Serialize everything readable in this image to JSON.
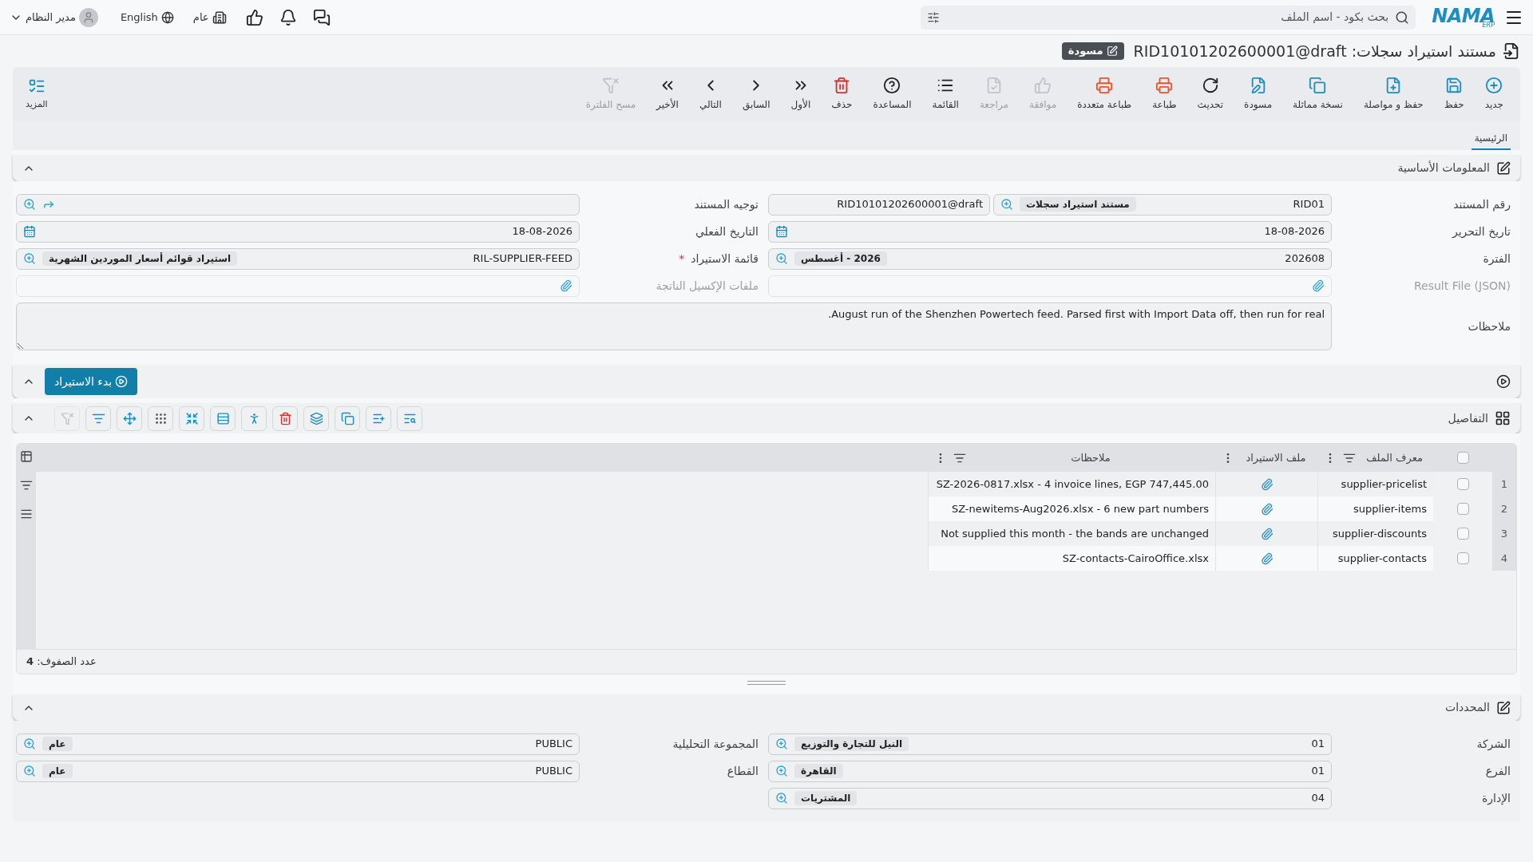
{
  "header": {
    "logo": "NAMA",
    "logo_sub": "ERP",
    "search": {
      "placeholder": "بحث بكود - اسم الملف"
    },
    "language": "English",
    "company": "عام",
    "user": "مدير النظام"
  },
  "document": {
    "title": "مستند استيراد سجلات: RID10101202600001@draft",
    "status": "مسودة"
  },
  "toolbar": [
    {
      "label": "جديد",
      "disabled": false
    },
    {
      "label": "حفظ",
      "disabled": false
    },
    {
      "label": "حفظ و مواصلة",
      "disabled": false
    },
    {
      "label": "نسخة مماثلة",
      "disabled": false
    },
    {
      "label": "مسودة",
      "disabled": false
    },
    {
      "label": "تحديث",
      "disabled": false
    },
    {
      "label": "طباعة",
      "disabled": false
    },
    {
      "label": "طباعة متعددة",
      "disabled": false
    },
    {
      "label": "موافقة",
      "disabled": true
    },
    {
      "label": "مراجعة",
      "disabled": true
    },
    {
      "label": "القائمة",
      "disabled": false
    },
    {
      "label": "المساعدة",
      "disabled": false
    },
    {
      "label": "حذف",
      "disabled": false
    },
    {
      "label": "الأول",
      "disabled": false
    },
    {
      "label": "السابق",
      "disabled": false
    },
    {
      "label": "التالي",
      "disabled": false
    },
    {
      "label": "الأخير",
      "disabled": false
    },
    {
      "label": "مسح الفلترة",
      "disabled": true
    }
  ],
  "more": "المزيد",
  "tabs": [
    {
      "label": "الرئيسية",
      "selected": true
    }
  ],
  "basic_info": {
    "title": "المعلومات الأساسية",
    "expanded": true,
    "fields": [
      {
        "kind": "lookup",
        "label": "رقم المستند",
        "value": "RID01",
        "tag": "مستند استيراد سجلات",
        "extra": "RID10101202600001@draft"
      },
      {
        "kind": "route",
        "label": "توجيه المستند"
      },
      {
        "kind": "date",
        "label": "تاريخ التحرير",
        "value": "18-08-2026"
      },
      {
        "kind": "date",
        "label": "التاريخ الفعلي",
        "value": "18-08-2026"
      },
      {
        "kind": "lookup",
        "label": "الفترة",
        "value": "202608",
        "tag": "2026 - أغسطس"
      },
      {
        "kind": "lookup",
        "label": "قائمة الاستيراد",
        "value": "RIL-SUPPLIER-FEED",
        "tag": "استيراد قوائم أسعار الموردين الشهرية",
        "required": true,
        "required_mark": "*"
      },
      {
        "kind": "file",
        "label": "Result File (JSON)"
      },
      {
        "kind": "file",
        "label": "ملفات الإكسيل الناتجة"
      }
    ],
    "notes": {
      "label": "ملاحظات",
      "value": "August run of the Shenzhen Powertech feed. Parsed first with Import Data off, then run for real."
    }
  },
  "run": {
    "button": "بدء الاستيراد",
    "expanded": true
  },
  "details": {
    "title": "التفاصيل",
    "expanded": true,
    "tools": [
      {
        "disabled": true
      },
      {
        "disabled": false
      },
      {
        "disabled": false
      },
      {
        "disabled": false
      },
      {
        "disabled": false
      },
      {
        "disabled": false
      },
      {
        "disabled": false
      },
      {
        "disabled": false
      },
      {
        "disabled": false
      },
      {
        "disabled": false
      },
      {
        "disabled": false
      },
      {
        "disabled": false
      }
    ],
    "header_checked": false,
    "columns": [
      "معرف الملف",
      "ملف الاستيراد",
      "ملاحظات"
    ],
    "rows": [
      {
        "number": "1",
        "checked": false,
        "id": "supplier-pricelist",
        "notes": "SZ-2026-0817.xlsx - 4 invoice lines, EGP 747,445.00"
      },
      {
        "number": "2",
        "checked": false,
        "id": "supplier-items",
        "notes": "SZ-newitems-Aug2026.xlsx - 6 new part numbers"
      },
      {
        "number": "3",
        "checked": false,
        "id": "supplier-discounts",
        "notes": "Not supplied this month - the bands are unchanged"
      },
      {
        "number": "4",
        "checked": false,
        "id": "supplier-contacts",
        "notes": "SZ-contacts-CairoOffice.xlsx"
      }
    ],
    "row_count": "عدد الصفوف: **4**"
  },
  "dimensions": {
    "title": "المحددات",
    "expanded": true,
    "fields": [
      {
        "kind": "lookup",
        "label": "الشركة",
        "value": "01",
        "tag": "النيل للتجارة والتوزيع"
      },
      {
        "kind": "lookup",
        "label": "المجموعة التحليلية",
        "value": "PUBLIC",
        "tag": "عام"
      },
      {
        "kind": "lookup",
        "label": "الفرع",
        "value": "01",
        "tag": "القاهرة"
      },
      {
        "kind": "lookup",
        "label": "القطاع",
        "value": "PUBLIC",
        "tag": "عام"
      },
      {
        "kind": "lookup",
        "label": "الإدارة",
        "value": "04",
        "tag": "المشتريات"
      }
    ]
  }
}
